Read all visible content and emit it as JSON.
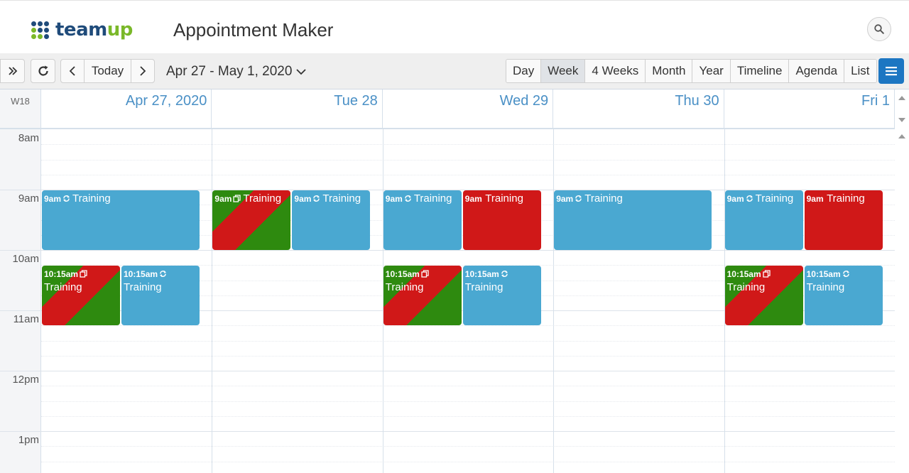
{
  "header": {
    "logo_part1": "team",
    "logo_part2": "up",
    "title": "Appointment Maker",
    "search_icon": "search-icon"
  },
  "toolbar": {
    "collapse_icon": "double-chevron-right-icon",
    "refresh_icon": "refresh-icon",
    "prev_icon": "chevron-left-icon",
    "today_label": "Today",
    "next_icon": "chevron-right-icon",
    "date_range": "Apr 27 - May 1, 2020",
    "views": [
      "Day",
      "Week",
      "4 Weeks",
      "Month",
      "Year",
      "Timeline",
      "Agenda",
      "List"
    ],
    "active_view": "Week",
    "menu_icon": "hamburger-menu-icon"
  },
  "calendar": {
    "week_label": "W18",
    "days": [
      "Apr 27, 2020",
      "Tue 28",
      "Wed 29",
      "Thu 30",
      "Fri 1"
    ],
    "hours": [
      "8am",
      "9am",
      "10am",
      "11am",
      "12pm",
      "1pm"
    ],
    "events": [
      {
        "day": 0,
        "slot": 0,
        "of": 1,
        "start": "9am",
        "time": "9am",
        "title": "Training",
        "color": "blue",
        "icon": "repeat-icon"
      },
      {
        "day": 1,
        "slot": 0,
        "of": 2,
        "start": "9am",
        "time": "9am",
        "title": "Training",
        "color": "stripe",
        "icon": "copy-icon"
      },
      {
        "day": 1,
        "slot": 1,
        "of": 2,
        "start": "9am",
        "time": "9am",
        "title": "Training",
        "color": "blue",
        "icon": "repeat-icon"
      },
      {
        "day": 2,
        "slot": 0,
        "of": 2,
        "start": "9am",
        "time": "9am",
        "title": "Training",
        "color": "blue",
        "icon": "repeat-icon"
      },
      {
        "day": 2,
        "slot": 1,
        "of": 2,
        "start": "9am",
        "time": "9am",
        "title": "Training",
        "color": "red",
        "icon": ""
      },
      {
        "day": 3,
        "slot": 0,
        "of": 1,
        "start": "9am",
        "time": "9am",
        "title": "Training",
        "color": "blue",
        "icon": "repeat-icon"
      },
      {
        "day": 4,
        "slot": 0,
        "of": 2,
        "start": "9am",
        "time": "9am",
        "title": "Training",
        "color": "blue",
        "icon": "repeat-icon"
      },
      {
        "day": 4,
        "slot": 1,
        "of": 2,
        "start": "9am",
        "time": "9am",
        "title": "Training",
        "color": "red",
        "icon": ""
      },
      {
        "day": 0,
        "slot": 0,
        "of": 2,
        "start": "10:15am",
        "time": "10:15am",
        "title": "Training",
        "color": "stripe",
        "icon": "copy-icon"
      },
      {
        "day": 0,
        "slot": 1,
        "of": 2,
        "start": "10:15am",
        "time": "10:15am",
        "title": "Training",
        "color": "blue",
        "icon": "repeat-icon"
      },
      {
        "day": 2,
        "slot": 0,
        "of": 2,
        "start": "10:15am",
        "time": "10:15am",
        "title": "Training",
        "color": "stripe",
        "icon": "copy-icon"
      },
      {
        "day": 2,
        "slot": 1,
        "of": 2,
        "start": "10:15am",
        "time": "10:15am",
        "title": "Training",
        "color": "blue",
        "icon": "repeat-icon"
      },
      {
        "day": 4,
        "slot": 0,
        "of": 2,
        "start": "10:15am",
        "time": "10:15am",
        "title": "Training",
        "color": "stripe",
        "icon": "copy-icon"
      },
      {
        "day": 4,
        "slot": 1,
        "of": 2,
        "start": "10:15am",
        "time": "10:15am",
        "title": "Training",
        "color": "blue",
        "icon": "repeat-icon"
      }
    ]
  },
  "colors": {
    "accent": "#1c76c2",
    "event_blue": "#4aa8d1",
    "event_red": "#d01818",
    "event_green": "#2e8a0f",
    "day_header_text": "#4a90c6"
  }
}
